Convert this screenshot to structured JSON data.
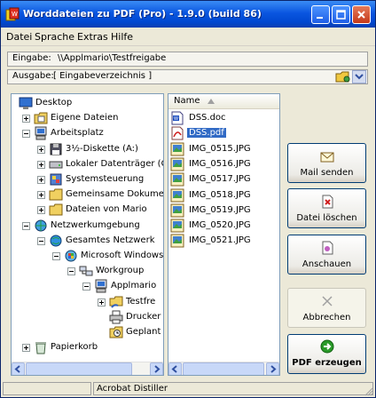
{
  "window": {
    "title": "Worddateien zu PDF (Pro) - 1.9.0 (build 86)"
  },
  "menu": [
    "Datei",
    "Sprache",
    "Extras",
    "Hilfe"
  ],
  "input_row": {
    "label": "Eingabe:",
    "value": "\\\\Applmario\\Testfreigabe"
  },
  "output_row": {
    "label": "Ausgabe:",
    "value": "[ Eingabeverzeichnis ]"
  },
  "tree": [
    {
      "label": "Desktop",
      "icon": "desktop-icon"
    },
    {
      "label": "Eigene Dateien",
      "icon": "my-documents-icon"
    },
    {
      "label": "Arbeitsplatz",
      "icon": "computer-icon"
    },
    {
      "label": "3½-Diskette (A:)",
      "icon": "floppy-icon"
    },
    {
      "label": "Lokaler Datenträger (C",
      "icon": "hard-drive-icon"
    },
    {
      "label": "Systemsteuerung",
      "icon": "control-panel-icon"
    },
    {
      "label": "Gemeinsame Dokumer",
      "icon": "folder-icon"
    },
    {
      "label": "Dateien von Mario",
      "icon": "folder-icon"
    },
    {
      "label": "Netzwerkumgebung",
      "icon": "network-icon"
    },
    {
      "label": "Gesamtes Netzwerk",
      "icon": "globe-icon"
    },
    {
      "label": "Microsoft Windows-",
      "icon": "windows-network-icon"
    },
    {
      "label": "Workgroup",
      "icon": "workgroup-icon"
    },
    {
      "label": "Applmario",
      "icon": "computer-icon"
    },
    {
      "label": "Testfre",
      "icon": "shared-folder-icon"
    },
    {
      "label": "Drucker",
      "icon": "printer-icon"
    },
    {
      "label": "Geplant",
      "icon": "scheduled-tasks-icon"
    },
    {
      "label": "Papierkorb",
      "icon": "recycle-bin-icon"
    }
  ],
  "files": {
    "column_header": "Name",
    "items": [
      {
        "name": "DSS.doc",
        "icon": "word-doc-icon"
      },
      {
        "name": "DSS.pdf",
        "icon": "pdf-icon"
      },
      {
        "name": "IMG_0515.JPG",
        "icon": "jpg-icon"
      },
      {
        "name": "IMG_0516.JPG",
        "icon": "jpg-icon"
      },
      {
        "name": "IMG_0517.JPG",
        "icon": "jpg-icon"
      },
      {
        "name": "IMG_0518.JPG",
        "icon": "jpg-icon"
      },
      {
        "name": "IMG_0519.JPG",
        "icon": "jpg-icon"
      },
      {
        "name": "IMG_0520.JPG",
        "icon": "jpg-icon"
      },
      {
        "name": "IMG_0521.JPG",
        "icon": "jpg-icon"
      }
    ],
    "selected": "DSS.pdf"
  },
  "buttons": {
    "mail": "Mail senden",
    "delete": "Datei löschen",
    "view": "Anschauen",
    "cancel": "Abbrechen",
    "convert": "PDF erzeugen"
  },
  "status": {
    "printer": "Acrobat Distiller"
  },
  "colors": {
    "titlebar": "#0a56e0",
    "selection": "#316ac5",
    "accent_green": "#2a9a2a"
  }
}
